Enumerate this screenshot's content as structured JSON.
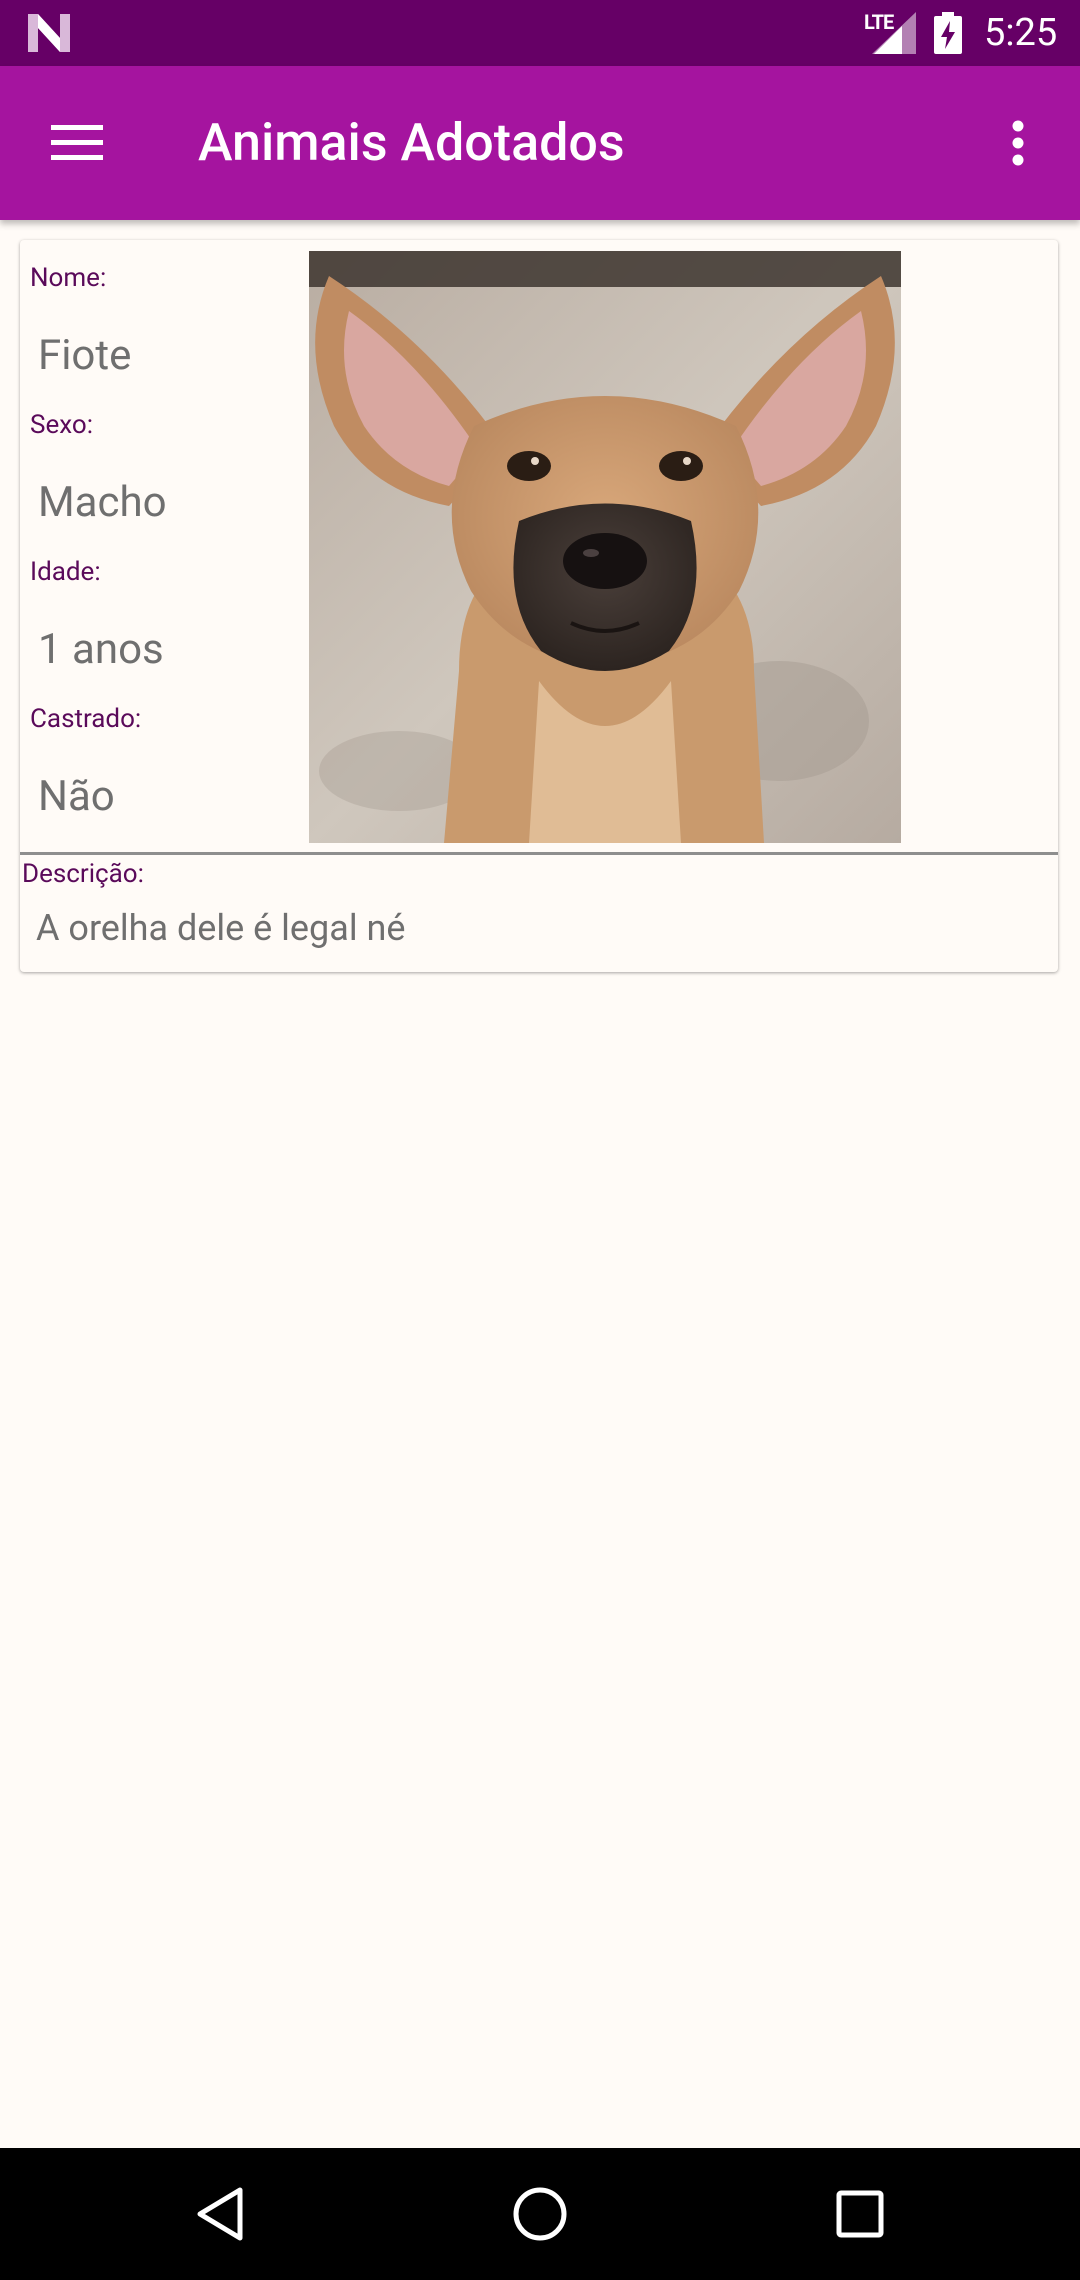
{
  "status_bar": {
    "network_type": "LTE",
    "time": "5:25",
    "icons": [
      "n-logo-icon",
      "signal-icon",
      "battery-charging-icon"
    ]
  },
  "app_bar": {
    "title": "Animais Adotados",
    "menu_icon": "hamburger-menu-icon",
    "more_icon": "more-vert-icon"
  },
  "animal": {
    "name_label": "Nome:",
    "name": "Fiote",
    "sex_label": "Sexo:",
    "sex": "Macho",
    "age_label": "Idade:",
    "age": "1 anos",
    "neutered_label": "Castrado:",
    "neutered": "Não",
    "description_label": "Descrição:",
    "description": "A orelha dele é legal né"
  },
  "colors": {
    "status_bar": "#660066",
    "app_bar": "#A5149F",
    "label": "#5A0A5A",
    "value": "#6F6F6F",
    "background": "#FFFBF7"
  },
  "nav_bar": {
    "icons": [
      "back-icon",
      "home-icon",
      "recents-icon"
    ]
  }
}
